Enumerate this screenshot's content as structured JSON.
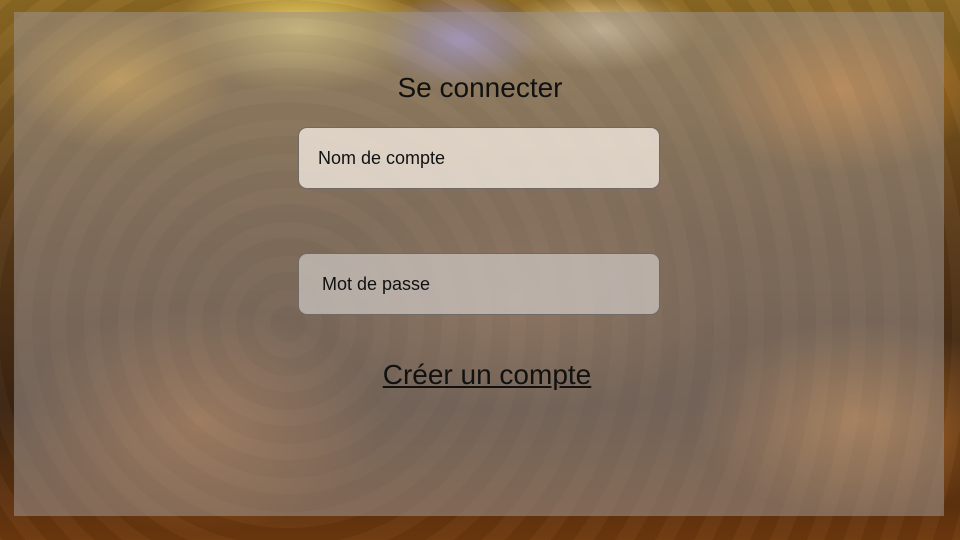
{
  "login": {
    "title": "Se connecter",
    "username_placeholder": "Nom de compte",
    "password_placeholder": "Mot de passe",
    "create_account_label": "Créer un compte"
  },
  "colors": {
    "panel_overlay": "#9b918a",
    "text": "#111111",
    "field_border": "#6f6a66"
  }
}
